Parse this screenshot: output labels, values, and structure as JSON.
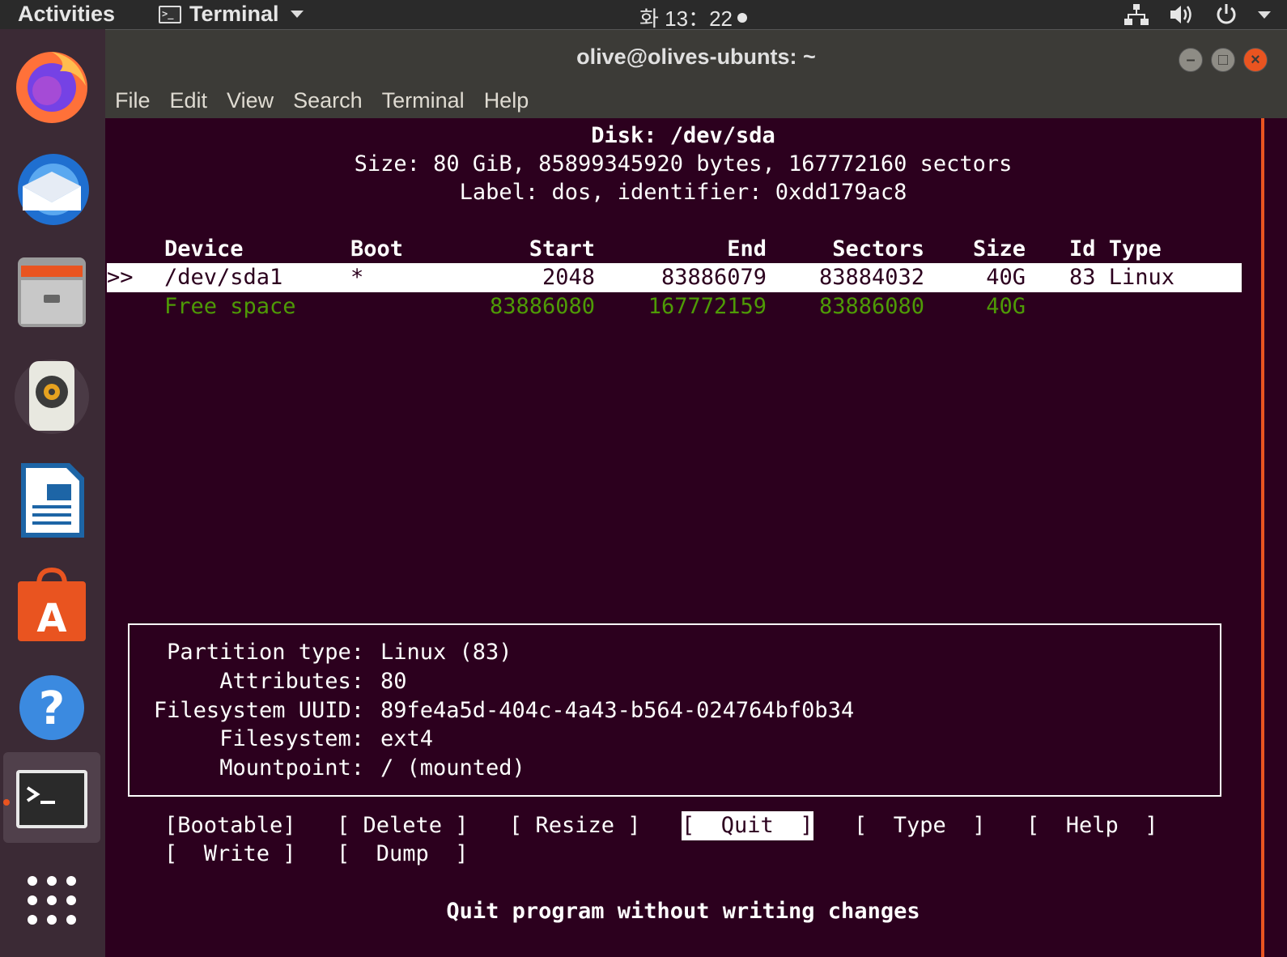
{
  "topbar": {
    "activities": "Activities",
    "app_menu": "Terminal",
    "clock": "화 13：22"
  },
  "window": {
    "title": "olive@olives-ubunts: ~",
    "menu": [
      "File",
      "Edit",
      "View",
      "Search",
      "Terminal",
      "Help"
    ]
  },
  "dock": {
    "items": [
      "firefox-icon",
      "thunderbird-icon",
      "files-icon",
      "rhythmbox-icon",
      "libreoffice-writer-icon",
      "ubuntu-software-icon",
      "help-icon",
      "terminal-icon",
      "show-apps-icon"
    ]
  },
  "cfdisk": {
    "header": {
      "disk": "Disk: /dev/sda",
      "size": "Size: 80 GiB, 85899345920 bytes, 167772160 sectors",
      "label": "Label: dos, identifier: 0xdd179ac8"
    },
    "columns": {
      "device": "Device",
      "boot": "Boot",
      "start": "Start",
      "end": "End",
      "sectors": "Sectors",
      "size": "Size",
      "id_type": "Id Type"
    },
    "rows": [
      {
        "marker": ">>",
        "device": "/dev/sda1",
        "boot": "*",
        "start": "2048",
        "end": "83886079",
        "sectors": "83884032",
        "size": "40G",
        "id_type": "83 Linux"
      },
      {
        "marker": "",
        "device": "Free space",
        "boot": "",
        "start": "83886080",
        "end": "167772159",
        "sectors": "83886080",
        "size": "40G",
        "id_type": ""
      }
    ],
    "info": {
      "partition_type": {
        "key": "Partition type:",
        "value": "Linux (83)"
      },
      "attributes": {
        "key": "Attributes:",
        "value": "80"
      },
      "fs_uuid": {
        "key": "Filesystem UUID:",
        "value": "89fe4a5d-404c-4a43-b564-024764bf0b34"
      },
      "filesystem": {
        "key": "Filesystem:",
        "value": "ext4"
      },
      "mountpoint": {
        "key": "Mountpoint:",
        "value": "/ (mounted)"
      }
    },
    "buttons": {
      "bootable": "[Bootable]",
      "delete": "[ Delete ]",
      "resize": "[ Resize ]",
      "quit": "[  Quit  ]",
      "type": "[  Type  ]",
      "help": "[  Help  ]",
      "write": "[  Write ]",
      "dump": "[  Dump  ]"
    },
    "status": "Quit program without writing changes"
  }
}
